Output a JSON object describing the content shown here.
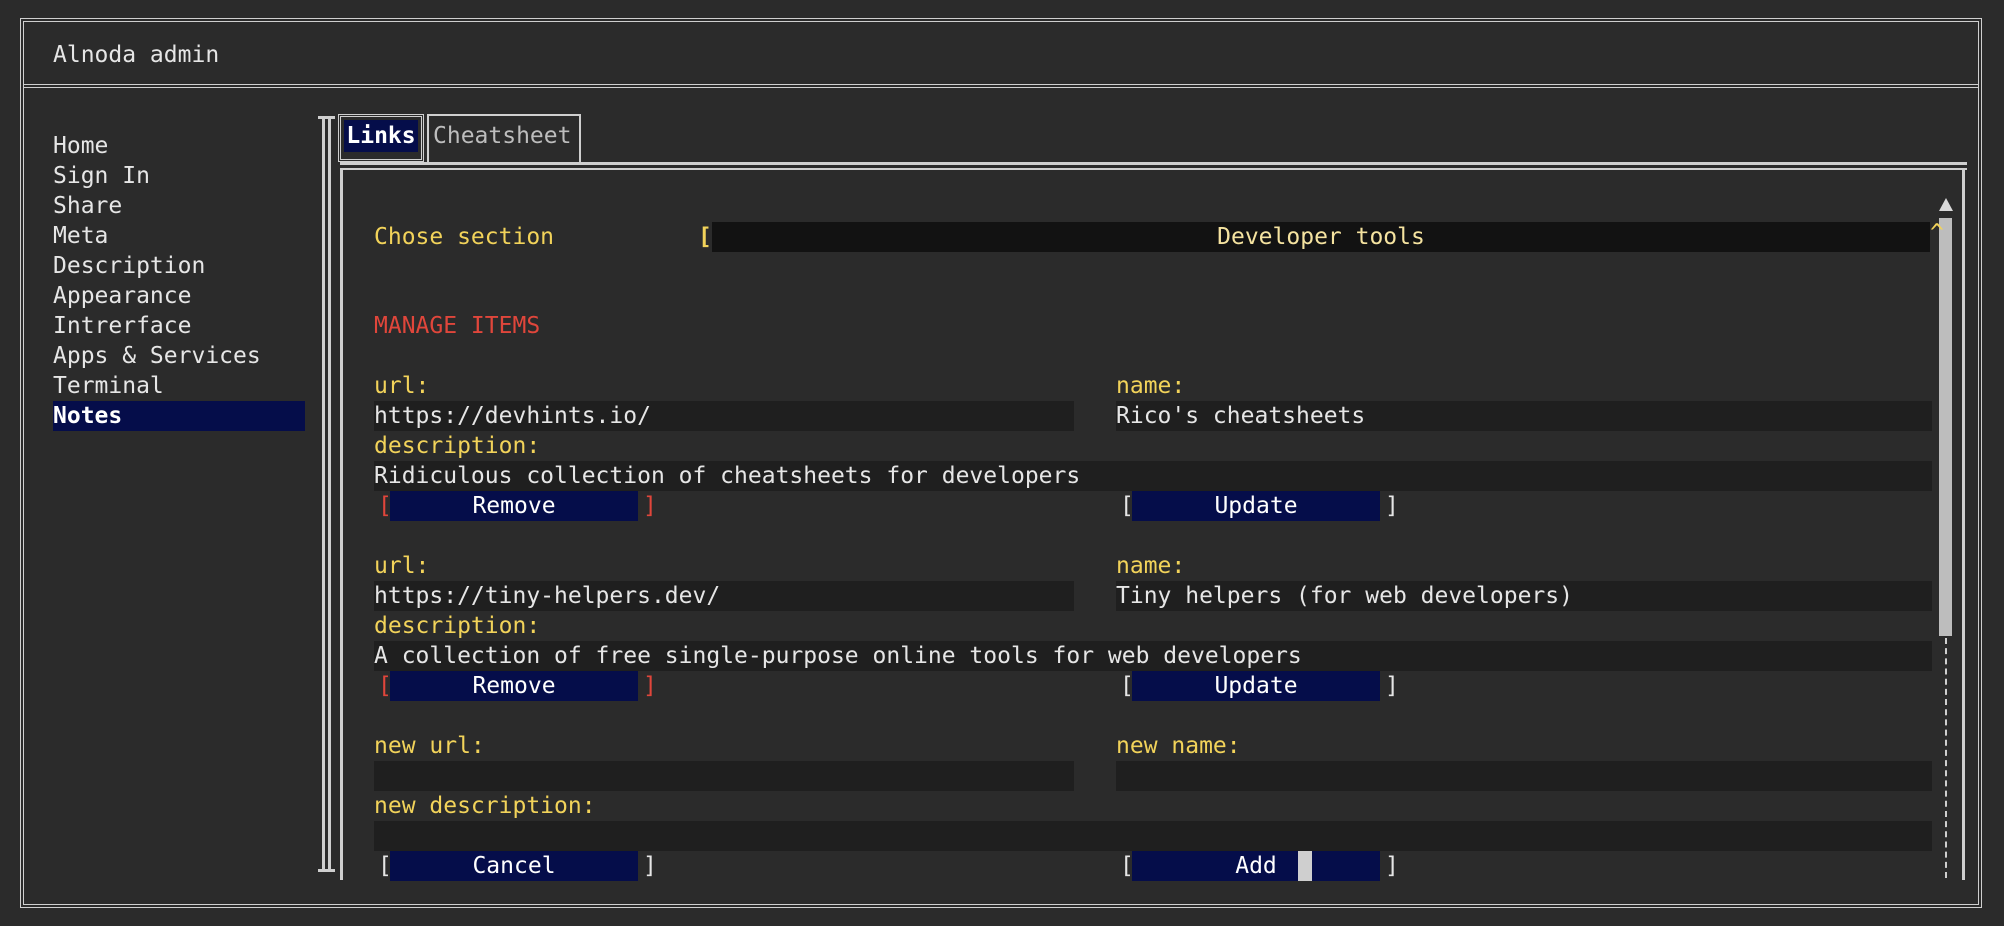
{
  "app": {
    "title": "Alnoda admin"
  },
  "sidebar": {
    "items": [
      {
        "label": "Home"
      },
      {
        "label": "Sign In"
      },
      {
        "label": "Share"
      },
      {
        "label": "Meta"
      },
      {
        "label": "Description"
      },
      {
        "label": "Appearance"
      },
      {
        "label": "Intrerface"
      },
      {
        "label": "Apps & Services"
      },
      {
        "label": "Terminal"
      },
      {
        "label": "Notes",
        "selected": true
      }
    ]
  },
  "tabs": [
    {
      "label": "Links",
      "active": true
    },
    {
      "label": "Cheatsheet",
      "active": false
    }
  ],
  "section": {
    "label": "Chose section",
    "value": "Developer tools",
    "open_bracket": "[",
    "arrow": "^"
  },
  "manage_heading": "MANAGE ITEMS",
  "items": [
    {
      "url_label": "url:",
      "url": "https://devhints.io/",
      "name_label": "name:",
      "name": "Rico's cheatsheets",
      "description_label": "description:",
      "description": "Ridiculous collection of cheatsheets for developers",
      "remove_label": "Remove",
      "update_label": "Update"
    },
    {
      "url_label": "url:",
      "url": "https://tiny-helpers.dev/",
      "name_label": "name:",
      "name": "Tiny helpers (for web developers)",
      "description_label": "description:",
      "description": "A collection of free single-purpose online tools for web developers",
      "remove_label": "Remove",
      "update_label": "Update"
    }
  ],
  "new_item": {
    "url_label": "new url:",
    "name_label": "new name:",
    "description_label": "new description:",
    "url": "",
    "name": "",
    "description": "",
    "cancel_label": "Cancel",
    "add_label": "Add"
  },
  "brackets": {
    "open": "[",
    "close": "]"
  },
  "colors": {
    "background": "#2b2b2b",
    "accent_yellow": "#f2d35a",
    "heading_red": "#e0463b",
    "button_bg": "#050d4a",
    "selection_bg": "#050d4a"
  }
}
